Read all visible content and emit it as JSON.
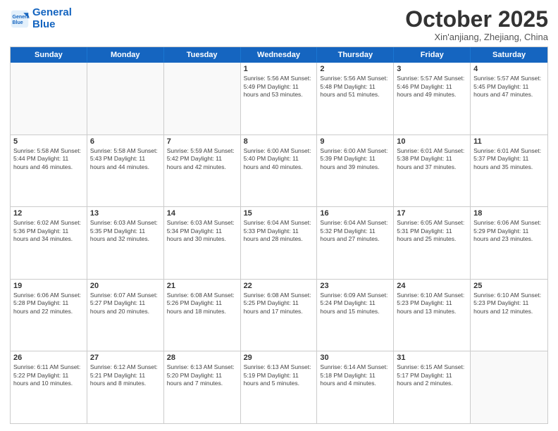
{
  "header": {
    "logo_line1": "General",
    "logo_line2": "Blue",
    "month_title": "October 2025",
    "subtitle": "Xin'anjiang, Zhejiang, China"
  },
  "day_headers": [
    "Sunday",
    "Monday",
    "Tuesday",
    "Wednesday",
    "Thursday",
    "Friday",
    "Saturday"
  ],
  "weeks": [
    [
      {
        "date": "",
        "info": ""
      },
      {
        "date": "",
        "info": ""
      },
      {
        "date": "",
        "info": ""
      },
      {
        "date": "1",
        "info": "Sunrise: 5:56 AM\nSunset: 5:49 PM\nDaylight: 11 hours and 53 minutes."
      },
      {
        "date": "2",
        "info": "Sunrise: 5:56 AM\nSunset: 5:48 PM\nDaylight: 11 hours and 51 minutes."
      },
      {
        "date": "3",
        "info": "Sunrise: 5:57 AM\nSunset: 5:46 PM\nDaylight: 11 hours and 49 minutes."
      },
      {
        "date": "4",
        "info": "Sunrise: 5:57 AM\nSunset: 5:45 PM\nDaylight: 11 hours and 47 minutes."
      }
    ],
    [
      {
        "date": "5",
        "info": "Sunrise: 5:58 AM\nSunset: 5:44 PM\nDaylight: 11 hours and 46 minutes."
      },
      {
        "date": "6",
        "info": "Sunrise: 5:58 AM\nSunset: 5:43 PM\nDaylight: 11 hours and 44 minutes."
      },
      {
        "date": "7",
        "info": "Sunrise: 5:59 AM\nSunset: 5:42 PM\nDaylight: 11 hours and 42 minutes."
      },
      {
        "date": "8",
        "info": "Sunrise: 6:00 AM\nSunset: 5:40 PM\nDaylight: 11 hours and 40 minutes."
      },
      {
        "date": "9",
        "info": "Sunrise: 6:00 AM\nSunset: 5:39 PM\nDaylight: 11 hours and 39 minutes."
      },
      {
        "date": "10",
        "info": "Sunrise: 6:01 AM\nSunset: 5:38 PM\nDaylight: 11 hours and 37 minutes."
      },
      {
        "date": "11",
        "info": "Sunrise: 6:01 AM\nSunset: 5:37 PM\nDaylight: 11 hours and 35 minutes."
      }
    ],
    [
      {
        "date": "12",
        "info": "Sunrise: 6:02 AM\nSunset: 5:36 PM\nDaylight: 11 hours and 34 minutes."
      },
      {
        "date": "13",
        "info": "Sunrise: 6:03 AM\nSunset: 5:35 PM\nDaylight: 11 hours and 32 minutes."
      },
      {
        "date": "14",
        "info": "Sunrise: 6:03 AM\nSunset: 5:34 PM\nDaylight: 11 hours and 30 minutes."
      },
      {
        "date": "15",
        "info": "Sunrise: 6:04 AM\nSunset: 5:33 PM\nDaylight: 11 hours and 28 minutes."
      },
      {
        "date": "16",
        "info": "Sunrise: 6:04 AM\nSunset: 5:32 PM\nDaylight: 11 hours and 27 minutes."
      },
      {
        "date": "17",
        "info": "Sunrise: 6:05 AM\nSunset: 5:31 PM\nDaylight: 11 hours and 25 minutes."
      },
      {
        "date": "18",
        "info": "Sunrise: 6:06 AM\nSunset: 5:29 PM\nDaylight: 11 hours and 23 minutes."
      }
    ],
    [
      {
        "date": "19",
        "info": "Sunrise: 6:06 AM\nSunset: 5:28 PM\nDaylight: 11 hours and 22 minutes."
      },
      {
        "date": "20",
        "info": "Sunrise: 6:07 AM\nSunset: 5:27 PM\nDaylight: 11 hours and 20 minutes."
      },
      {
        "date": "21",
        "info": "Sunrise: 6:08 AM\nSunset: 5:26 PM\nDaylight: 11 hours and 18 minutes."
      },
      {
        "date": "22",
        "info": "Sunrise: 6:08 AM\nSunset: 5:25 PM\nDaylight: 11 hours and 17 minutes."
      },
      {
        "date": "23",
        "info": "Sunrise: 6:09 AM\nSunset: 5:24 PM\nDaylight: 11 hours and 15 minutes."
      },
      {
        "date": "24",
        "info": "Sunrise: 6:10 AM\nSunset: 5:23 PM\nDaylight: 11 hours and 13 minutes."
      },
      {
        "date": "25",
        "info": "Sunrise: 6:10 AM\nSunset: 5:23 PM\nDaylight: 11 hours and 12 minutes."
      }
    ],
    [
      {
        "date": "26",
        "info": "Sunrise: 6:11 AM\nSunset: 5:22 PM\nDaylight: 11 hours and 10 minutes."
      },
      {
        "date": "27",
        "info": "Sunrise: 6:12 AM\nSunset: 5:21 PM\nDaylight: 11 hours and 8 minutes."
      },
      {
        "date": "28",
        "info": "Sunrise: 6:13 AM\nSunset: 5:20 PM\nDaylight: 11 hours and 7 minutes."
      },
      {
        "date": "29",
        "info": "Sunrise: 6:13 AM\nSunset: 5:19 PM\nDaylight: 11 hours and 5 minutes."
      },
      {
        "date": "30",
        "info": "Sunrise: 6:14 AM\nSunset: 5:18 PM\nDaylight: 11 hours and 4 minutes."
      },
      {
        "date": "31",
        "info": "Sunrise: 6:15 AM\nSunset: 5:17 PM\nDaylight: 11 hours and 2 minutes."
      },
      {
        "date": "",
        "info": ""
      }
    ]
  ]
}
